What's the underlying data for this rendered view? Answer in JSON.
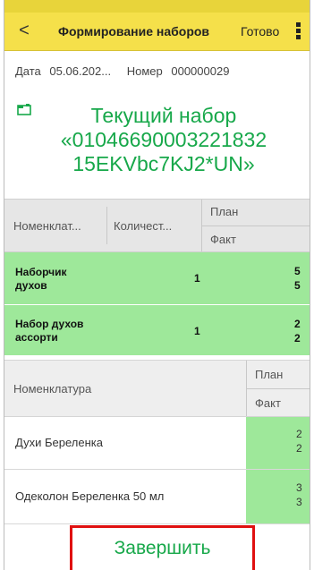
{
  "appbar": {
    "back_label": "<",
    "title": "Формирование наборов",
    "done_label": "Готово"
  },
  "doc": {
    "date_label": "Дата",
    "date_value": "05.06.202...",
    "number_label": "Номер",
    "number_value": "000000029"
  },
  "current_kit": {
    "lines": [
      "Текущий набор",
      "«01046690003221832",
      "15EKVbc7KJ2*UN»"
    ]
  },
  "table1": {
    "headers": {
      "name": "Номенклат...",
      "qty": "Количест...",
      "plan": "План",
      "fact": "Факт"
    },
    "rows": [
      {
        "name_line1": "Наборчик",
        "name_line2": "духов",
        "qty": "1",
        "plan": "5",
        "fact": "5"
      },
      {
        "name_line1": "Набор духов",
        "name_line2": "ассорти",
        "qty": "1",
        "plan": "2",
        "fact": "2"
      }
    ]
  },
  "table2": {
    "headers": {
      "name": "Номенклатура",
      "plan": "План",
      "fact": "Факт"
    },
    "rows": [
      {
        "name": "Духи Береленка",
        "plan": "2",
        "fact": "2"
      },
      {
        "name": "Одеколон Береленка 50 мл",
        "plan": "3",
        "fact": "3"
      }
    ]
  },
  "finish_button": {
    "label": "Завершить"
  },
  "colors": {
    "appbar": "#f5e04a",
    "green_text": "#17a84a",
    "green_fill": "#9ee89a",
    "highlight_border": "#e01010"
  }
}
